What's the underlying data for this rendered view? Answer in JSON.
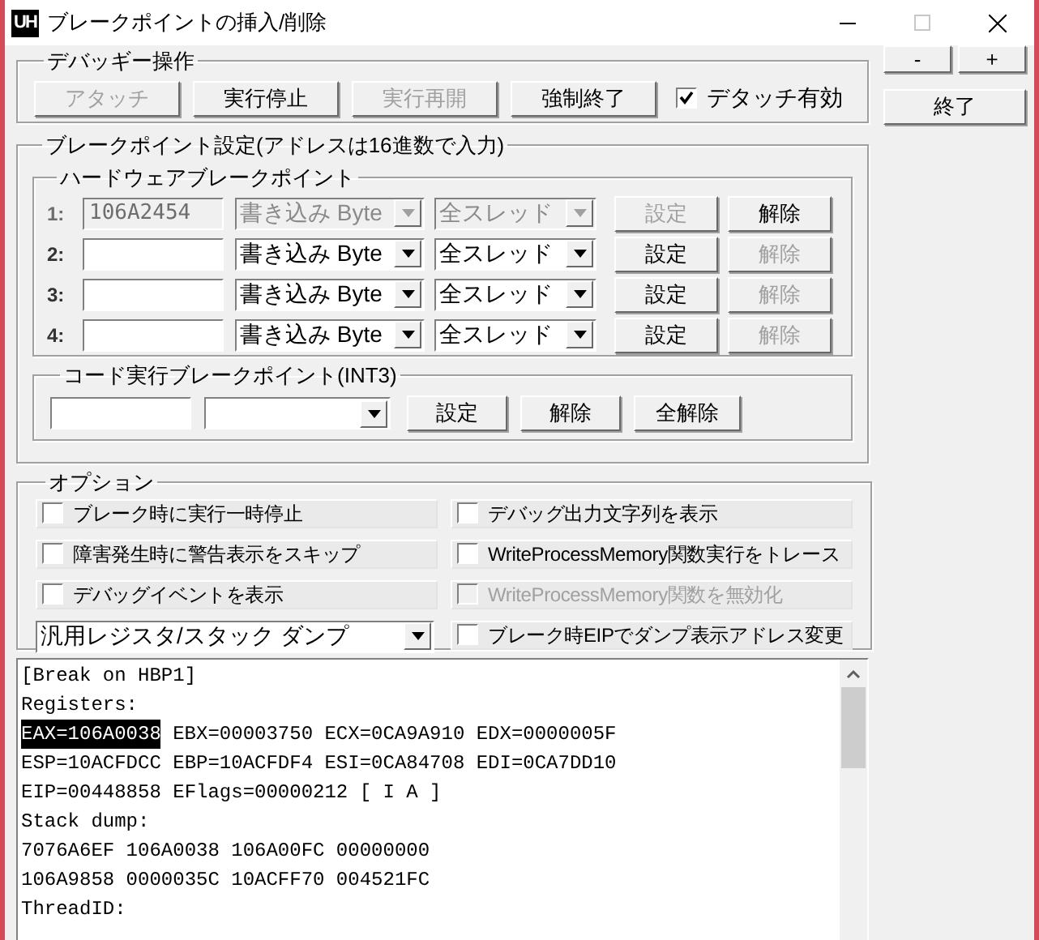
{
  "window": {
    "icon_text": "UH",
    "title": "ブレークポイントの挿入/削除"
  },
  "debuggee": {
    "title": "デバッギー操作",
    "buttons": [
      {
        "label": "アタッチ",
        "disabled": true
      },
      {
        "label": "実行停止",
        "disabled": false
      },
      {
        "label": "実行再開",
        "disabled": true
      },
      {
        "label": "強制終了",
        "disabled": false
      }
    ],
    "detach": {
      "label": "デタッチ有効",
      "checked": true
    }
  },
  "side_buttons": [
    {
      "label": "-"
    },
    {
      "label": "+"
    },
    {
      "label": "終了"
    }
  ],
  "breakpoints": {
    "title": "ブレークポイント設定(アドレスは16進数で入力)",
    "hardware": {
      "title": "ハードウェアブレークポイント",
      "rows": [
        {
          "index": "1:",
          "address": "106A2454",
          "type": "書き込み Byte",
          "thread": "全スレッド",
          "disabled": true,
          "set_label": "設定",
          "clear_label": "解除",
          "clear_disabled": false
        },
        {
          "index": "2:",
          "type": "書き込み Byte",
          "thread": "全スレッド",
          "disabled": false,
          "set_label": "設定",
          "clear_label": "解除",
          "clear_disabled": true
        },
        {
          "index": "3:",
          "type": "書き込み Byte",
          "thread": "全スレッド",
          "disabled": false,
          "set_label": "設定",
          "clear_label": "解除",
          "clear_disabled": true
        },
        {
          "index": "4:",
          "type": "書き込み Byte",
          "thread": "全スレッド",
          "disabled": false,
          "set_label": "設定",
          "clear_label": "解除",
          "clear_disabled": true
        }
      ]
    },
    "code": {
      "title": "コード実行ブレークポイント(INT3)",
      "buttons": [
        "設定",
        "解除",
        "全解除"
      ]
    }
  },
  "options": {
    "title": "オプション",
    "left": [
      {
        "kind": "checkbox",
        "label": "ブレーク時に実行一時停止",
        "checked": false,
        "disabled": false
      },
      {
        "kind": "checkbox",
        "label": "障害発生時に警告表示をスキップ",
        "checked": false,
        "disabled": false
      },
      {
        "kind": "checkbox",
        "label": "デバッグイベントを表示",
        "checked": false,
        "disabled": false
      },
      {
        "kind": "dropdown",
        "value": "汎用レジスタ/スタック ダンプ"
      }
    ],
    "right": [
      {
        "kind": "checkbox",
        "label": "デバッグ出力文字列を表示",
        "checked": false,
        "disabled": false
      },
      {
        "kind": "checkbox",
        "label": "WriteProcessMemory関数実行をトレース",
        "checked": false,
        "disabled": false
      },
      {
        "kind": "checkbox",
        "label": "WriteProcessMemory関数を無効化",
        "checked": false,
        "disabled": true
      },
      {
        "kind": "checkbox",
        "label": "ブレーク時EIPでダンプ表示アドレス変更",
        "checked": false,
        "disabled": false
      }
    ]
  },
  "log": {
    "lines": [
      [
        {
          "text": "[Break on HBP1]",
          "selected": false
        }
      ],
      [
        {
          "text": "Registers:",
          "selected": false
        }
      ],
      [
        {
          "text": "EAX=106A0038",
          "selected": true
        },
        {
          "text": "EBX=00003750 ECX=0CA9A910 EDX=0000005F",
          "selected": false
        }
      ],
      [
        {
          "text": "ESP=10ACFDCC EBP=10ACFDF4 ESI=0CA84708 EDI=0CA7DD10",
          "selected": false
        }
      ],
      [
        {
          "text": "EIP=00448858 EFlags=00000212 [ I A ]",
          "selected": false
        }
      ],
      [
        {
          "text": "Stack dump:",
          "selected": false
        }
      ],
      [
        {
          "text": "7076A6EF 106A0038 106A00FC 00000000",
          "selected": false
        }
      ],
      [
        {
          "text": "106A9858 0000035C 10ACFF70 004521FC",
          "selected": false
        }
      ],
      [
        {
          "text": "ThreadID:",
          "selected": false
        }
      ]
    ]
  }
}
